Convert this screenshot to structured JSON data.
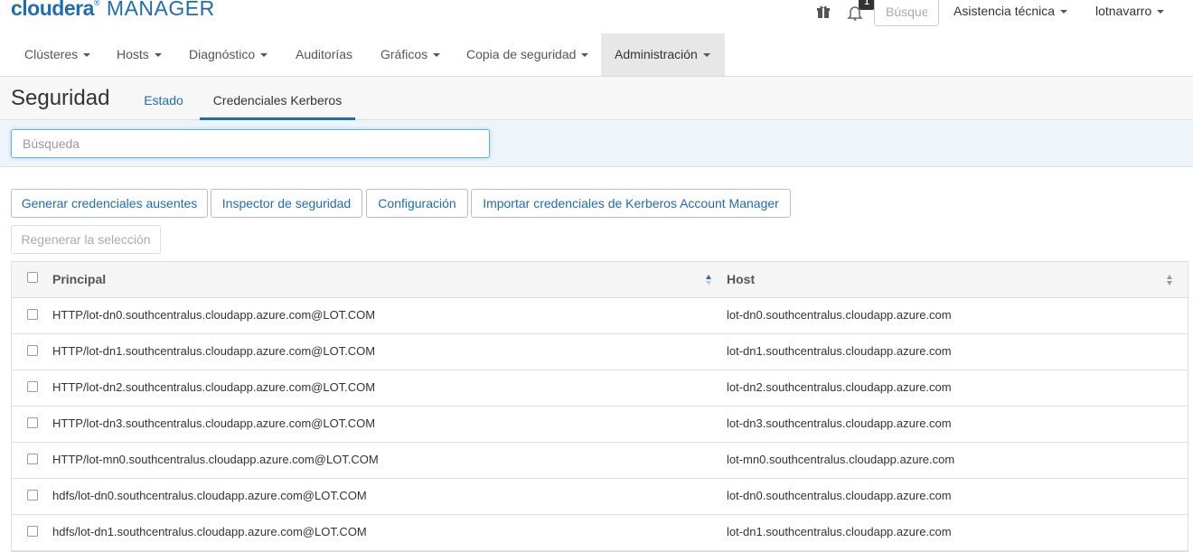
{
  "header": {
    "logo_brand": "cloudera",
    "logo_reg": "®",
    "logo_product": "MANAGER",
    "notification_count": "1",
    "search_placeholder": "Búsqueda",
    "support_label": "Asistencia técnica",
    "user_label": "lotnavarro",
    "icons": [
      "gift-icon",
      "notification-bell-icon"
    ]
  },
  "nav": {
    "items": [
      {
        "label": "Clústeres",
        "dropdown": true
      },
      {
        "label": "Hosts",
        "dropdown": true
      },
      {
        "label": "Diagnóstico",
        "dropdown": true
      },
      {
        "label": "Auditorías",
        "dropdown": false
      },
      {
        "label": "Gráficos",
        "dropdown": true
      },
      {
        "label": "Copia de seguridad",
        "dropdown": true
      },
      {
        "label": "Administración",
        "dropdown": true,
        "active": true
      }
    ]
  },
  "page": {
    "title": "Seguridad",
    "tabs": [
      {
        "label": "Estado",
        "active": false
      },
      {
        "label": "Credenciales Kerberos",
        "active": true
      }
    ]
  },
  "filter": {
    "placeholder": "Búsqueda"
  },
  "actions": {
    "generate": "Generar credenciales ausentes",
    "inspector": "Inspector de seguridad",
    "config": "Configuración",
    "import": "Importar credenciales de Kerberos Account Manager",
    "regenerate": "Regenerar la selección"
  },
  "table": {
    "columns": [
      "Principal",
      "Host"
    ],
    "rows": [
      {
        "principal": "HTTP/lot-dn0.southcentralus.cloudapp.azure.com@LOT.COM",
        "host": "lot-dn0.southcentralus.cloudapp.azure.com"
      },
      {
        "principal": "HTTP/lot-dn1.southcentralus.cloudapp.azure.com@LOT.COM",
        "host": "lot-dn1.southcentralus.cloudapp.azure.com"
      },
      {
        "principal": "HTTP/lot-dn2.southcentralus.cloudapp.azure.com@LOT.COM",
        "host": "lot-dn2.southcentralus.cloudapp.azure.com"
      },
      {
        "principal": "HTTP/lot-dn3.southcentralus.cloudapp.azure.com@LOT.COM",
        "host": "lot-dn3.southcentralus.cloudapp.azure.com"
      },
      {
        "principal": "HTTP/lot-mn0.southcentralus.cloudapp.azure.com@LOT.COM",
        "host": "lot-mn0.southcentralus.cloudapp.azure.com"
      },
      {
        "principal": "hdfs/lot-dn0.southcentralus.cloudapp.azure.com@LOT.COM",
        "host": "lot-dn0.southcentralus.cloudapp.azure.com"
      },
      {
        "principal": "hdfs/lot-dn1.southcentralus.cloudapp.azure.com@LOT.COM",
        "host": "lot-dn1.southcentralus.cloudapp.azure.com"
      }
    ]
  },
  "colors": {
    "brand": "#1f6cb0",
    "active_nav_bg": "#e7e7e7",
    "filter_bg": "#eef5fa"
  }
}
